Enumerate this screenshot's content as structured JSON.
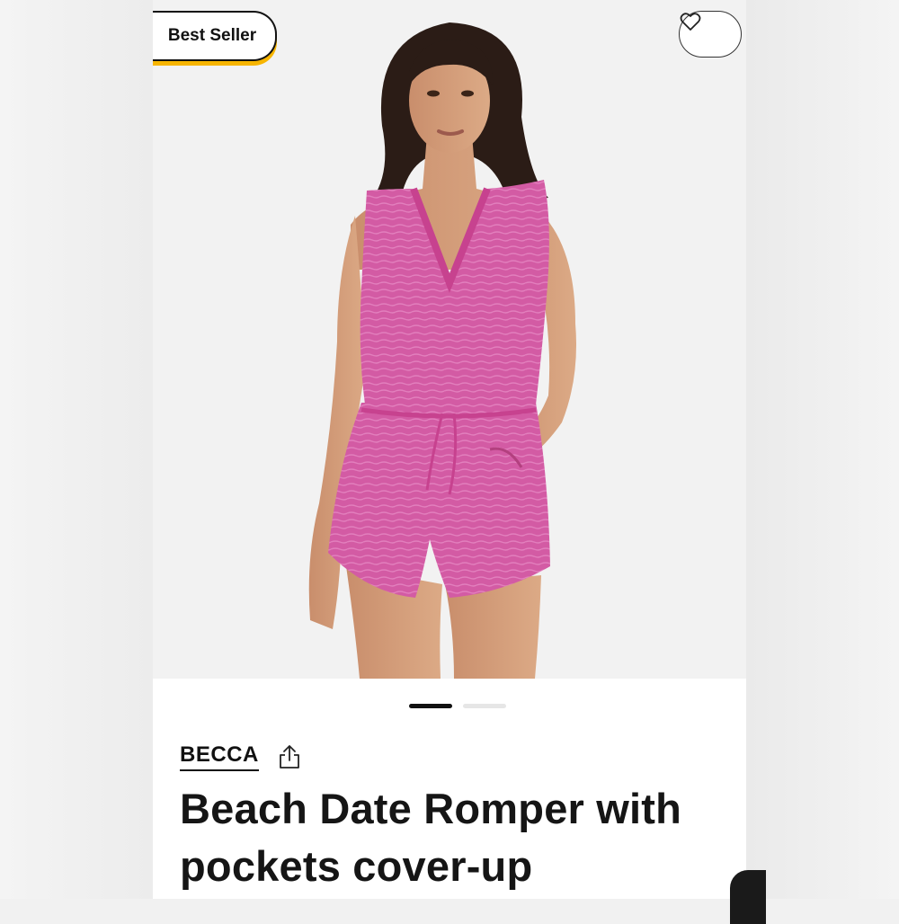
{
  "product": {
    "badge_label": "Best Seller",
    "brand": "BECCA",
    "title": "Beach Date Romper with pockets cover-up",
    "image_count": 2,
    "active_image_index": 1
  },
  "icons": {
    "favorite": "heart-icon",
    "share": "share-icon"
  },
  "colors": {
    "badge_accent": "#f7b500",
    "garment": "#d14f9c",
    "pager_active": "#111111",
    "pager_inactive": "#e6e6e6"
  }
}
